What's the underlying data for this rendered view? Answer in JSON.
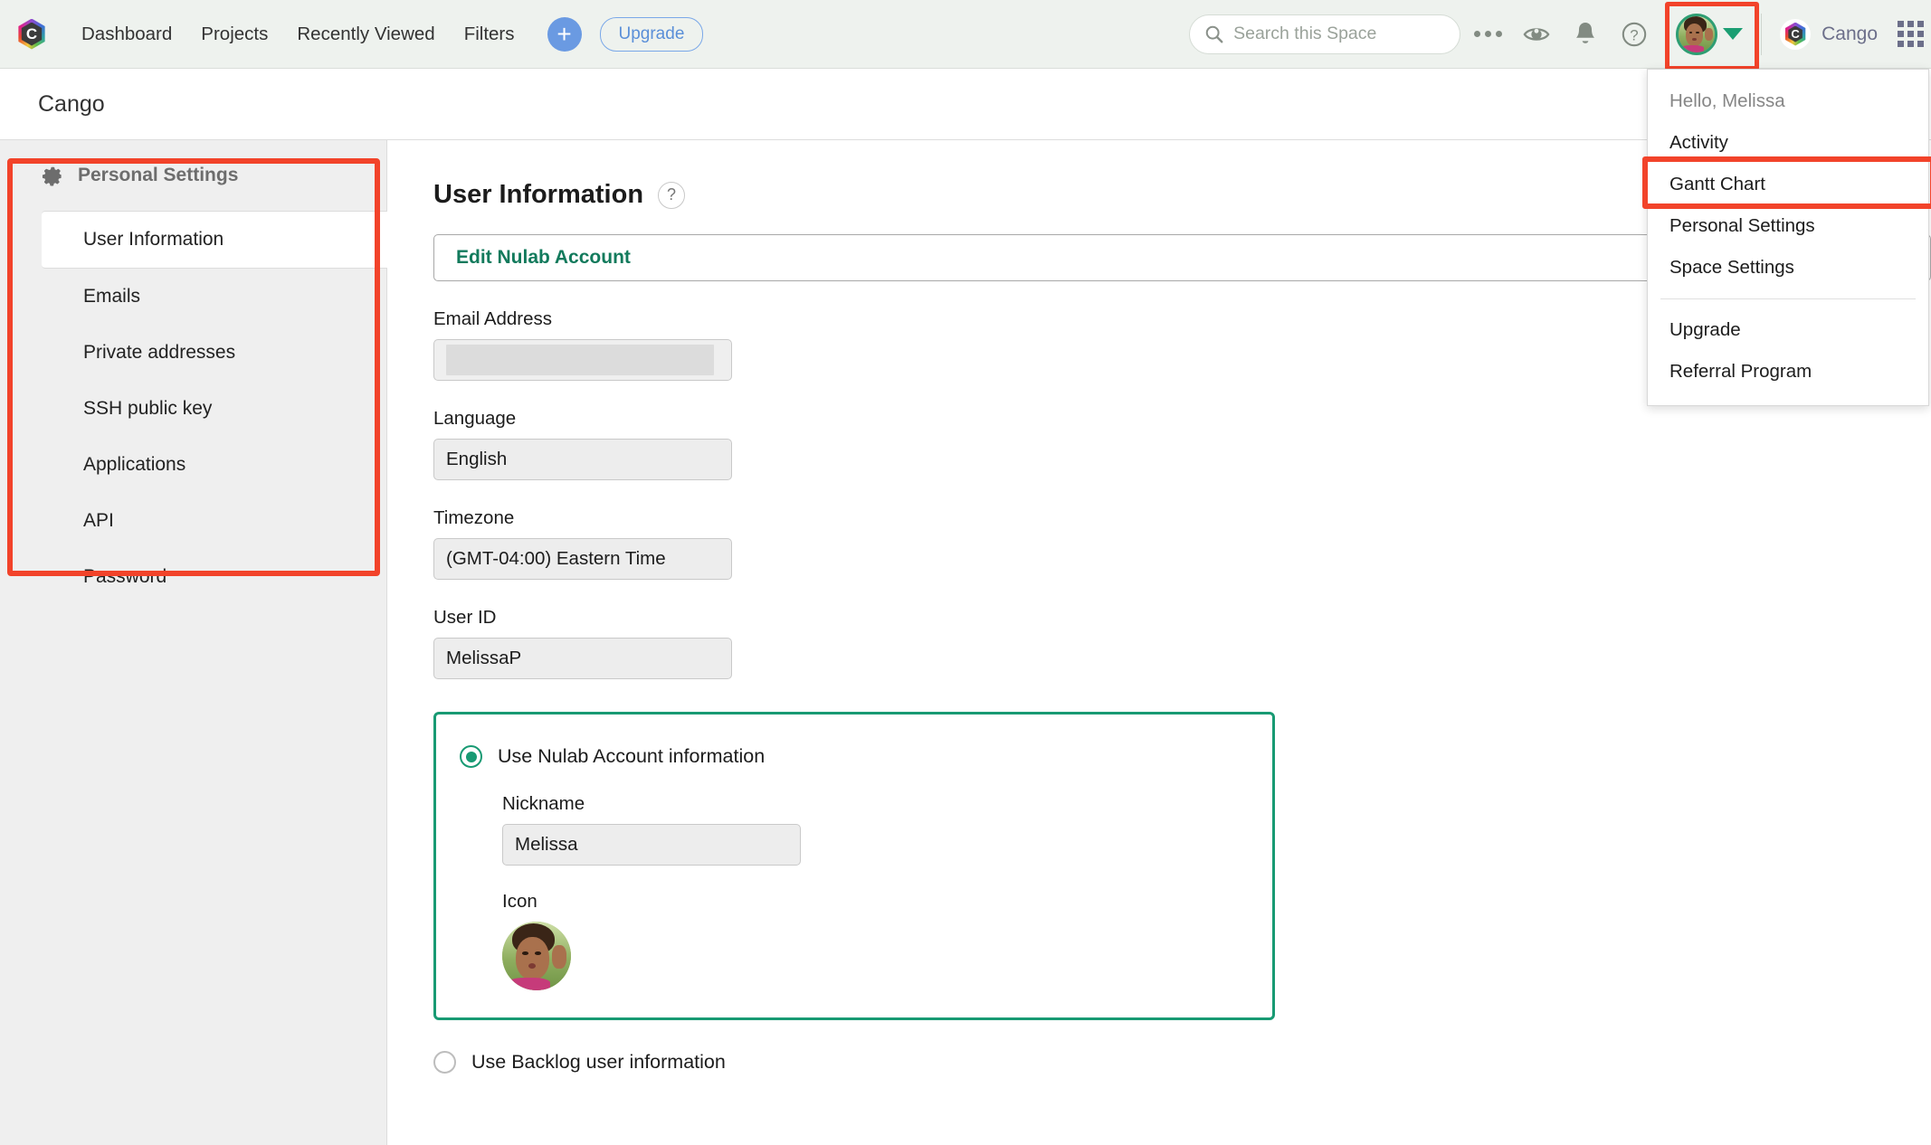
{
  "topnav": {
    "logo_letter": "C",
    "links": [
      "Dashboard",
      "Projects",
      "Recently Viewed",
      "Filters"
    ],
    "add_label": "+",
    "upgrade_label": "Upgrade",
    "search_placeholder": "Search this Space",
    "space_name": "Cango",
    "space_letter": "C"
  },
  "titlebar": {
    "title": "Cango"
  },
  "sidebar": {
    "section_title": "Personal Settings",
    "items": [
      {
        "label": "User Information",
        "active": true
      },
      {
        "label": "Emails",
        "active": false
      },
      {
        "label": "Private addresses",
        "active": false
      },
      {
        "label": "SSH public key",
        "active": false
      },
      {
        "label": "Applications",
        "active": false
      },
      {
        "label": "API",
        "active": false
      },
      {
        "label": "Password",
        "active": false
      }
    ]
  },
  "main": {
    "heading": "User Information",
    "help_glyph": "?",
    "edit_account_button": "Edit Nulab Account",
    "fields": [
      {
        "label": "Email Address",
        "value": "",
        "redacted": true
      },
      {
        "label": "Language",
        "value": "English",
        "redacted": false
      },
      {
        "label": "Timezone",
        "value": "(GMT-04:00) Eastern Time",
        "redacted": false
      },
      {
        "label": "User ID",
        "value": "MelissaP",
        "redacted": false
      }
    ],
    "nulab_option": {
      "label": "Use Nulab Account information",
      "selected": true,
      "nickname_label": "Nickname",
      "nickname_value": "Melissa",
      "icon_label": "Icon"
    },
    "backlog_option": {
      "label": "Use Backlog user information",
      "selected": false
    }
  },
  "menu": {
    "greeting": "Hello, Melissa",
    "items": [
      "Activity",
      "Gantt Chart",
      "Personal Settings",
      "Space Settings"
    ],
    "footer_items": [
      "Upgrade",
      "Referral Program"
    ]
  },
  "colors": {
    "accent_green": "#189a73",
    "highlight_red": "#f2432a",
    "link_blue": "#6a9ae2",
    "topnav_bg": "#eef2ee",
    "sidebar_bg": "#efefef"
  }
}
